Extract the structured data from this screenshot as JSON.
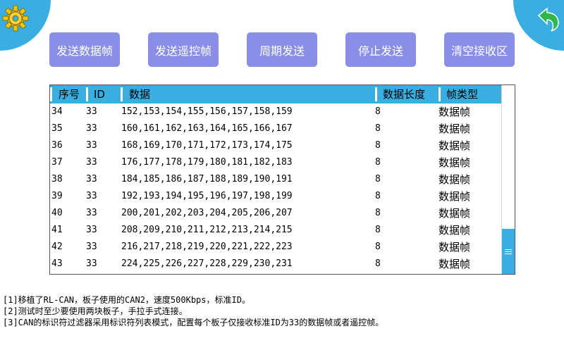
{
  "icons": {
    "settings": "gear-icon",
    "back": "return-arrow-icon"
  },
  "colors": {
    "accent": "#3aaee0",
    "button_bg": "#8b8ee6",
    "button_text": "#ffffff",
    "gear": "#f2c511"
  },
  "toolbar": {
    "send_data_frame": "发送数据帧",
    "send_remote_frame": "发送遥控帧",
    "periodic_send": "周期发送",
    "stop_send": "停止发送",
    "clear_receive": "清空接收区"
  },
  "table": {
    "headers": {
      "seq": "序号",
      "id": "ID",
      "data": "数据",
      "length": "数据长度",
      "frame_type": "帧类型"
    },
    "rows": [
      {
        "seq": "34",
        "id": "33",
        "data": "152,153,154,155,156,157,158,159",
        "length": "8",
        "type": "数据帧"
      },
      {
        "seq": "35",
        "id": "33",
        "data": "160,161,162,163,164,165,166,167",
        "length": "8",
        "type": "数据帧"
      },
      {
        "seq": "36",
        "id": "33",
        "data": "168,169,170,171,172,173,174,175",
        "length": "8",
        "type": "数据帧"
      },
      {
        "seq": "37",
        "id": "33",
        "data": "176,177,178,179,180,181,182,183",
        "length": "8",
        "type": "数据帧"
      },
      {
        "seq": "38",
        "id": "33",
        "data": "184,185,186,187,188,189,190,191",
        "length": "8",
        "type": "数据帧"
      },
      {
        "seq": "39",
        "id": "33",
        "data": "192,193,194,195,196,197,198,199",
        "length": "8",
        "type": "数据帧"
      },
      {
        "seq": "40",
        "id": "33",
        "data": "200,201,202,203,204,205,206,207",
        "length": "8",
        "type": "数据帧"
      },
      {
        "seq": "41",
        "id": "33",
        "data": "208,209,210,211,212,213,214,215",
        "length": "8",
        "type": "数据帧"
      },
      {
        "seq": "42",
        "id": "33",
        "data": "216,217,218,219,220,221,222,223",
        "length": "8",
        "type": "数据帧"
      },
      {
        "seq": "43",
        "id": "33",
        "data": "224,225,226,227,228,229,230,231",
        "length": "8",
        "type": "数据帧"
      }
    ]
  },
  "notes": [
    "[1]移植了RL-CAN，板子使用的CAN2，速度500Kbps，标准ID。",
    "[2]测试时至少要使用两块板子，手拉手式连接。",
    "[3]CAN的标识符过滤器采用标识符列表模式，配置每个板子仅接收标准ID为33的数据帧或者遥控帧。"
  ]
}
